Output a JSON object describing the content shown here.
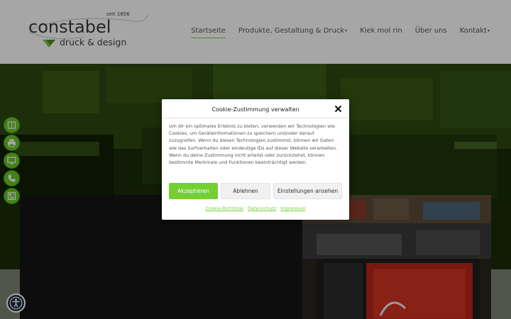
{
  "logo": {
    "brand": "constabel",
    "since": "seit 1856",
    "sub": "druck & design"
  },
  "nav": {
    "items": [
      {
        "label": "Startseite"
      },
      {
        "label": "Produkte, Gestaltung & Druck",
        "caret": "▾"
      },
      {
        "label": "Kiek mol rin"
      },
      {
        "label": "Über uns"
      },
      {
        "label": "Kontakt",
        "caret": "▾"
      }
    ]
  },
  "side_buttons": {
    "icons": [
      "book-icon",
      "printer-icon",
      "monitor-icon",
      "phone-icon",
      "newspaper-icon"
    ],
    "color": "#68c728"
  },
  "accessibility": {
    "icon": "accessibility-icon",
    "color": "#1f2a44"
  },
  "cookie": {
    "title": "Cookie-Zustimmung verwalten",
    "body": "Um dir ein optimales Erlebnis zu bieten, verwenden wir Technologien wie Cookies, um Geräteinformationen zu speichern und/oder darauf zuzugreifen. Wenn du diesen Technologien zustimmst, können wir Daten wie das Surfverhalten oder eindeutige IDs auf dieser Website verarbeiten. Wenn du deine Zustimmung nicht erteilst oder zurückziehst, können bestimmte Merkmale und Funktionen beeinträchtigt werden.",
    "accept": "Akzeptieren",
    "deny": "Ablehnen",
    "preferences": "Einstellungen ansehen",
    "links": [
      "Cookie-Richtlinie",
      "Datenschutz",
      "Impressum"
    ],
    "accent": "#74cf33"
  }
}
